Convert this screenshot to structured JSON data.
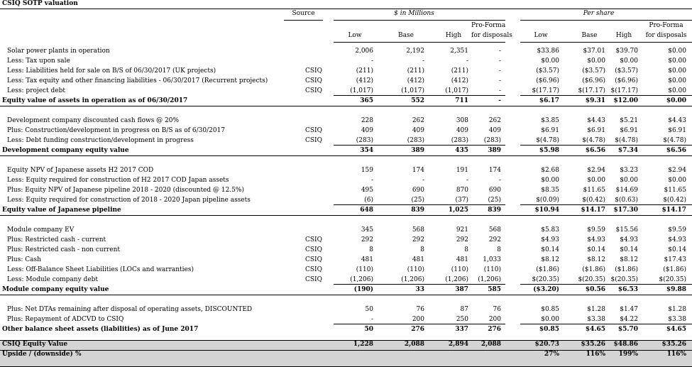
{
  "title": "CSIQ SOTP valuation",
  "header": {
    "source": "Source",
    "millions": "$ in Millions",
    "pershare": "Per share",
    "proforma1": "Pro-Forma",
    "proforma2": "for disposals",
    "low": "Low",
    "base": "Base",
    "high": "High"
  },
  "rows": [
    {
      "label": "Solar power plants in operation",
      "src": "",
      "v": [
        "2,006",
        "2,192",
        "2,351",
        "-"
      ],
      "p": [
        "$33.86",
        "$37.01",
        "$39.70",
        "$0.00"
      ]
    },
    {
      "label": "Less: Tax upon sale",
      "src": "",
      "v": [
        "-",
        "-",
        "-",
        "-"
      ],
      "p": [
        "$0.00",
        "$0.00",
        "$0.00",
        "$0.00"
      ]
    },
    {
      "label": "Less: Liabilities held for sale on B/S of 06/30/2017 (UK projects)",
      "src": "CSIQ",
      "v": [
        "(211)",
        "(211)",
        "(211)",
        "-"
      ],
      "p": [
        "($3.57)",
        "($3.57)",
        "($3.57)",
        "$0.00"
      ]
    },
    {
      "label": "Less: Tax equity and other financing liabilities - 06/30/2017 (Recurrent projects)",
      "src": "CSIQ",
      "v": [
        "(412)",
        "(412)",
        "(412)",
        "-"
      ],
      "p": [
        "($6.96)",
        "($6.96)",
        "($6.96)",
        "$0.00"
      ]
    },
    {
      "label": "Less: project debt",
      "src": "CSIQ",
      "v": [
        "(1,017)",
        "(1,017)",
        "(1,017)",
        "-"
      ],
      "p": [
        "$(17.17)",
        "$(17.17)",
        "$(17.17)",
        "$0.00"
      ]
    },
    {
      "label": "Equity value of assets in operation as of 06/30/2017",
      "src": "",
      "v": [
        "365",
        "552",
        "711",
        "-"
      ],
      "p": [
        "$6.17",
        "$9.31",
        "$12.00",
        "$0.00"
      ]
    },
    {
      "label": "Development company discounted cash flows @ 20%",
      "src": "",
      "v": [
        "228",
        "262",
        "308",
        "262"
      ],
      "p": [
        "$3.85",
        "$4.43",
        "$5.21",
        "$4.43"
      ]
    },
    {
      "label": "Plus: Construction/development in progress on B/S as of 6/30/2017",
      "src": "CSIQ",
      "v": [
        "409",
        "409",
        "409",
        "409"
      ],
      "p": [
        "$6.91",
        "$6.91",
        "$6.91",
        "$6.91"
      ]
    },
    {
      "label": "Less: Debt funding construction/development in progress",
      "src": "CSIQ",
      "v": [
        "(283)",
        "(283)",
        "(283)",
        "(283)"
      ],
      "p": [
        "$(4.78)",
        "$(4.78)",
        "$(4.78)",
        "$(4.78)"
      ]
    },
    {
      "label": "Development company equity value",
      "src": "",
      "v": [
        "354",
        "389",
        "435",
        "389"
      ],
      "p": [
        "$5.98",
        "$6.56",
        "$7.34",
        "$6.56"
      ]
    },
    {
      "label": "Equity NPV of Japanese assets H2 2017 COD",
      "src": "",
      "v": [
        "159",
        "174",
        "191",
        "174"
      ],
      "p": [
        "$2.68",
        "$2.94",
        "$3.23",
        "$2.94"
      ]
    },
    {
      "label": "Less: Equity required for construction of H2 2017 COD Japan assets",
      "src": "",
      "v": [
        "-",
        "-",
        "-",
        "-"
      ],
      "p": [
        "$0.00",
        "$0.00",
        "$0.00",
        "$0.00"
      ]
    },
    {
      "label": "Plus: Equity NPV of Japanese pipeline 2018 - 2020 (discounted @ 12.5%)",
      "src": "",
      "v": [
        "495",
        "690",
        "870",
        "690"
      ],
      "p": [
        "$8.35",
        "$11.65",
        "$14.69",
        "$11.65"
      ]
    },
    {
      "label": "Less: Equity required for construction of 2018 - 2020 Japan pipeline assets",
      "src": "",
      "v": [
        "(6)",
        "(25)",
        "(37)",
        "(25)"
      ],
      "p": [
        "$(0.09)",
        "$(0.42)",
        "$(0.63)",
        "$(0.42)"
      ]
    },
    {
      "label": "Equity value of Japanese pipeline",
      "src": "",
      "v": [
        "648",
        "839",
        "1,025",
        "839"
      ],
      "p": [
        "$10.94",
        "$14.17",
        "$17.30",
        "$14.17"
      ]
    },
    {
      "label": "Module company  EV",
      "src": "",
      "v": [
        "345",
        "568",
        "921",
        "568"
      ],
      "p": [
        "$5.83",
        "$9.59",
        "$15.56",
        "$9.59"
      ]
    },
    {
      "label": "Plus: Restricted cash - current",
      "src": "CSIQ",
      "v": [
        "292",
        "292",
        "292",
        "292"
      ],
      "p": [
        "$4.93",
        "$4.93",
        "$4.93",
        "$4.93"
      ]
    },
    {
      "label": "Plus: Restricted cash - non current",
      "src": "CSIQ",
      "v": [
        "8",
        "8",
        "8",
        "8"
      ],
      "p": [
        "$0.14",
        "$0.14",
        "$0.14",
        "$0.14"
      ]
    },
    {
      "label": "Plus: Cash",
      "src": "CSIQ",
      "v": [
        "481",
        "481",
        "481",
        "1,033"
      ],
      "p": [
        "$8.12",
        "$8.12",
        "$8.12",
        "$17.43"
      ]
    },
    {
      "label": "Less: Off-Balance Sheet Liabilities (LOCs and warranties)",
      "src": "CSIQ",
      "v": [
        "(110)",
        "(110)",
        "(110)",
        "(110)"
      ],
      "p": [
        "($1.86)",
        "($1.86)",
        "($1.86)",
        "($1.86)"
      ]
    },
    {
      "label": "Less: Module company debt",
      "src": "CSIQ",
      "v": [
        "(1,206)",
        "(1,206)",
        "(1,206)",
        "(1,206)"
      ],
      "p": [
        "$(20.35)",
        "$(20.35)",
        "$(20.35)",
        "$(20.35)"
      ]
    },
    {
      "label": "Module company equity value",
      "src": "",
      "v": [
        "(190)",
        "33",
        "387",
        "585"
      ],
      "p": [
        "($3.20)",
        "$0.56",
        "$6.53",
        "$9.88"
      ]
    },
    {
      "label": "Plus: Net DTAs remaining after disposal of operating assets, DISCOUNTED",
      "src": "",
      "v": [
        "50",
        "76",
        "87",
        "76"
      ],
      "p": [
        "$0.85",
        "$1.28",
        "$1.47",
        "$1.28"
      ]
    },
    {
      "label": "Plus: Repayment of ADCVD to CSIQ",
      "src": "",
      "v": [
        "-",
        "200",
        "250",
        "200"
      ],
      "p": [
        "$0.00",
        "$3.38",
        "$4.22",
        "$3.38"
      ]
    },
    {
      "label": "Other balance sheet assets (liabilities) as of June 2017",
      "src": "",
      "v": [
        "50",
        "276",
        "337",
        "276"
      ],
      "p": [
        "$0.85",
        "$4.65",
        "$5.70",
        "$4.65"
      ]
    },
    {
      "label": "CSIQ Equity Value",
      "src": "",
      "v": [
        "1,228",
        "2,088",
        "2,894",
        "2,088"
      ],
      "p": [
        "$20.73",
        "$35.26",
        "$48.86",
        "$35.26"
      ]
    },
    {
      "label": "Upside / (downside) %",
      "src": "",
      "v": [
        "",
        "",
        "",
        ""
      ],
      "p": [
        "27%",
        "116%",
        "199%",
        "116%"
      ]
    }
  ]
}
